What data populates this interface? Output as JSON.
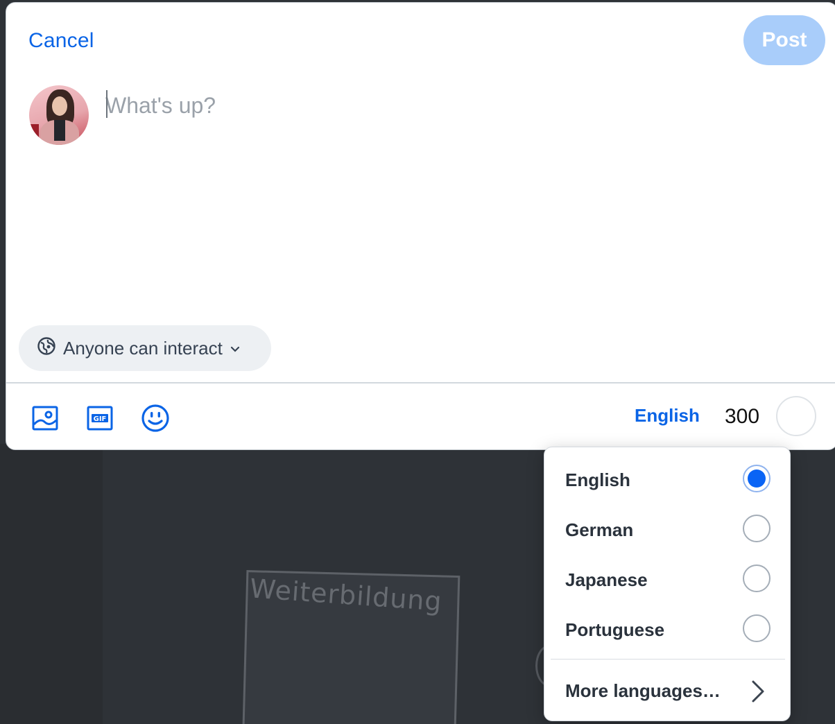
{
  "background": {
    "board_text": "Weiterbildung"
  },
  "header": {
    "cancel_label": "Cancel",
    "post_label": "Post"
  },
  "composer": {
    "placeholder": "What's up?",
    "avatar": "user-avatar"
  },
  "interaction_setting": {
    "label": "Anyone can interact",
    "icon": "globe-icon"
  },
  "toolbar": {
    "image_icon": "image-icon",
    "gif_icon": "gif-icon",
    "gif_text": "GIF",
    "emoji_icon": "emoji-icon",
    "language_label": "English",
    "char_count": "300"
  },
  "language_menu": {
    "options": [
      {
        "label": "English",
        "selected": true
      },
      {
        "label": "German",
        "selected": false
      },
      {
        "label": "Japanese",
        "selected": false
      },
      {
        "label": "Portuguese",
        "selected": false
      }
    ],
    "more_label": "More languages…"
  },
  "colors": {
    "accent": "#0a64e6",
    "post_disabled": "#a9cdfa",
    "overlay": "#2e3237"
  }
}
